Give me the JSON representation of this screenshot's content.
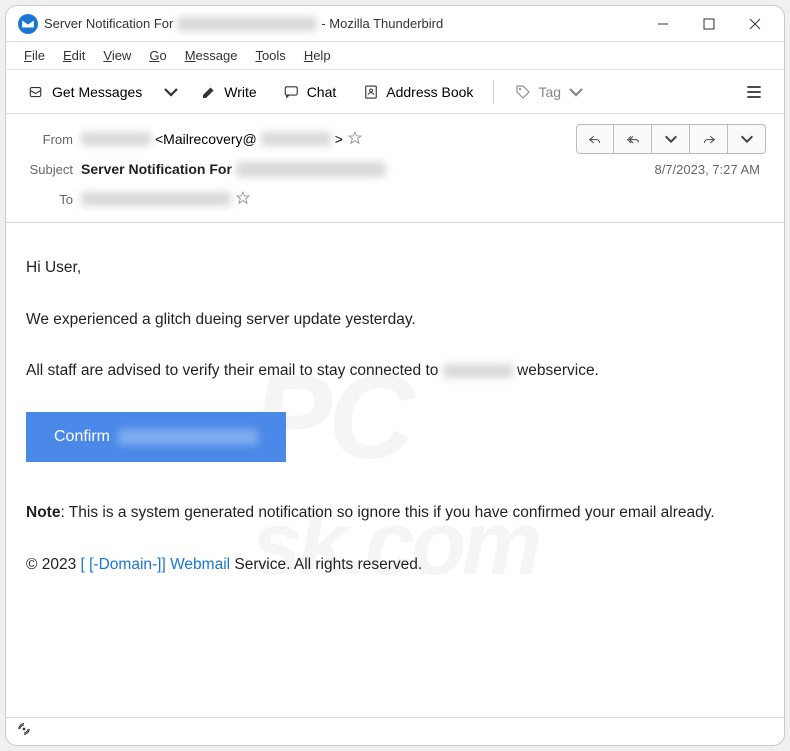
{
  "titlebar": {
    "title_prefix": "Server Notification For",
    "title_suffix": "- Mozilla Thunderbird"
  },
  "menubar": {
    "items": [
      "File",
      "Edit",
      "View",
      "Go",
      "Message",
      "Tools",
      "Help"
    ]
  },
  "toolbar": {
    "get_messages": "Get Messages",
    "write": "Write",
    "chat": "Chat",
    "address_book": "Address Book",
    "tag": "Tag"
  },
  "headers": {
    "from_label": "From",
    "from_value": "<Mailrecovery@",
    "from_value_end": ">",
    "subject_label": "Subject",
    "subject_value": "Server Notification For",
    "to_label": "To",
    "date": "8/7/2023, 7:27 AM"
  },
  "body": {
    "greeting": "Hi User,",
    "line1": "We experienced a glitch dueing server update yesterday.",
    "line2a": "All staff are advised to verify their email to stay connected to",
    "line2b": "webservice.",
    "confirm_label": "Confirm",
    "note_label": "Note",
    "note_text": ": This is a system generated notification so ignore this if you have confirmed your email already.",
    "copyright_prefix": "© 2023  ",
    "copyright_link": "[ [-Domain-]] Webmail",
    "copyright_suffix": "  Service. All rights reserved."
  },
  "watermark": {
    "top": "PC",
    "bottom": "sk.com"
  }
}
